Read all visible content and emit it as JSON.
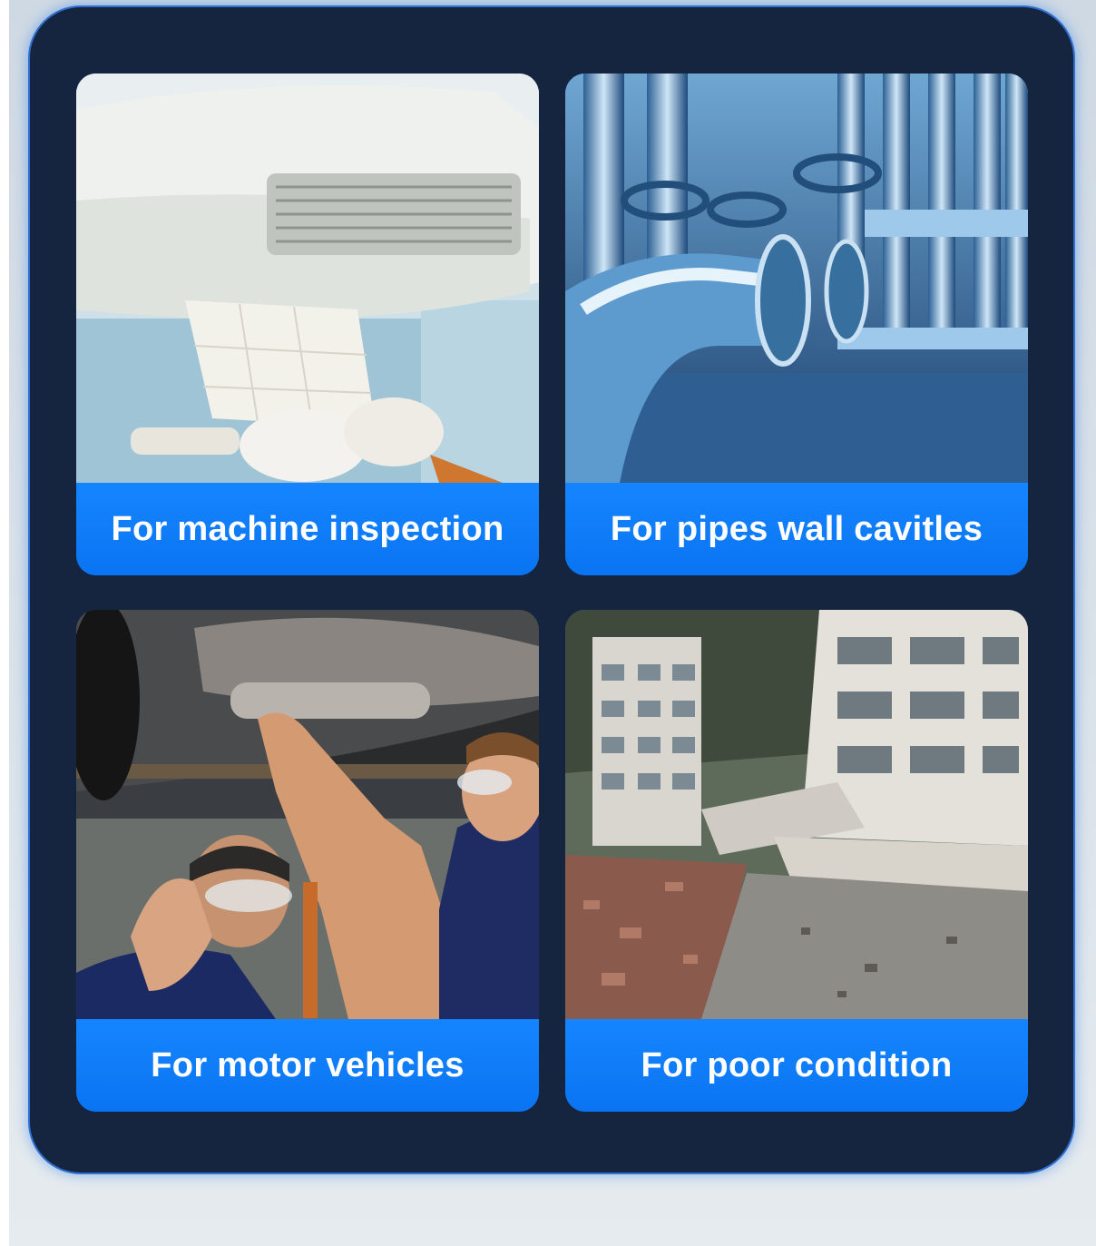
{
  "cards": [
    {
      "label": "For machine inspection",
      "image": "air-conditioner-maintenance-photo"
    },
    {
      "label": "For pipes wall cavitles",
      "image": "industrial-pipes-valves-photo"
    },
    {
      "label": "For motor vehicles",
      "image": "car-underside-mechanics-photo"
    },
    {
      "label": "For poor condition",
      "image": "collapsed-buildings-rubble-photo"
    }
  ],
  "colors": {
    "panel": "#15243f",
    "panel_glow": "#2f6fd0",
    "caption": "#0e79ff",
    "background": "#d6dfe7"
  }
}
